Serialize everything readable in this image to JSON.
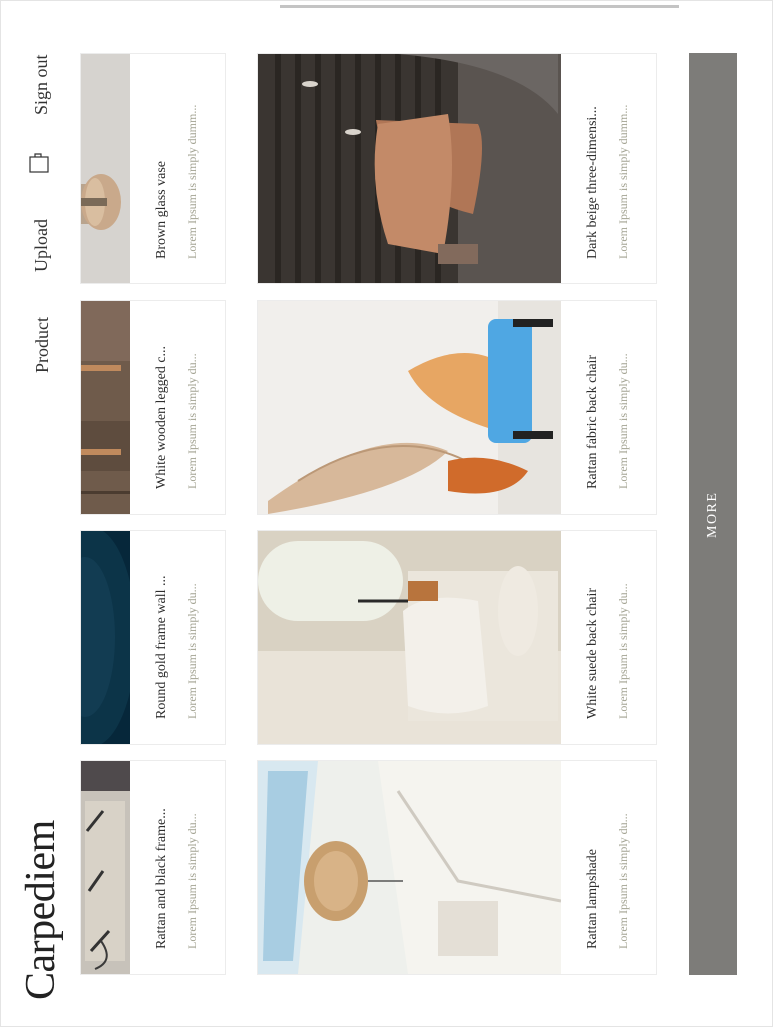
{
  "brand": "Carpediem",
  "nav": {
    "product": "Product",
    "upload": "Upload",
    "bag_icon": "bag-icon",
    "signout": "Sign out"
  },
  "products_small": [
    {
      "title": "Brown glass vase",
      "desc": "Lorem Ipsum is simply dumm..."
    },
    {
      "title": "White wooden legged c...",
      "desc": "Lorem Ipsum is simply du..."
    },
    {
      "title": "Round gold frame wall ...",
      "desc": "Lorem Ipsum is simply du..."
    },
    {
      "title": "Rattan and black frame...",
      "desc": "Lorem Ipsum is simply du..."
    }
  ],
  "products_large": [
    {
      "title": "Dark beige three-dimensi...",
      "desc": "Lorem Ipsum is simply dumm..."
    },
    {
      "title": "Rattan fabric back chair",
      "desc": "Lorem Ipsum is simply du..."
    },
    {
      "title": "White suede back chair",
      "desc": "Lorem Ipsum is simply du..."
    },
    {
      "title": "Rattan lampshade",
      "desc": "Lorem Ipsum is simply du..."
    }
  ],
  "more_label": "MORE",
  "colors": {
    "more_bg": "#7d7c79",
    "desc_text": "#a3a392"
  }
}
